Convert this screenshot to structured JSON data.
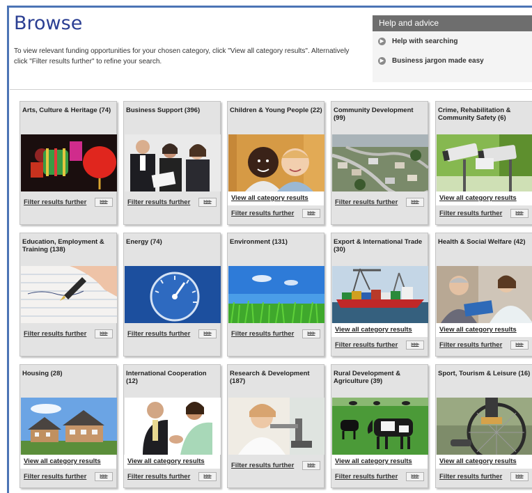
{
  "page": {
    "title": "Browse",
    "intro": "To view relevant funding opportunities for your chosen category, click \"View all category results\". Alternatively click \"Filter results further\" to refine your search."
  },
  "help": {
    "heading": "Help and advice",
    "items": [
      "Help with searching",
      "Business jargon made easy"
    ]
  },
  "labels": {
    "view_all": "View all category results",
    "filter": "Filter results further"
  },
  "icons": {
    "bullet": "arrow-bullet-icon",
    "arrows": "triple-arrow-icon"
  },
  "categories": [
    {
      "title": "Arts, Culture & Heritage (74)",
      "image": "red-lanterns",
      "has_view_all": false
    },
    {
      "title": "Business Support (396)",
      "image": "business-people",
      "has_view_all": false
    },
    {
      "title": "Children & Young People (22)",
      "image": "two-children",
      "has_view_all": true
    },
    {
      "title": "Community Development (99)",
      "image": "aerial-housing-estate",
      "has_view_all": false
    },
    {
      "title": "Crime, Rehabilitation & Community Safety (6)",
      "image": "cctv-cameras",
      "has_view_all": true
    },
    {
      "title": "Education, Employment & Training (138)",
      "image": "hand-writing",
      "has_view_all": false
    },
    {
      "title": "Energy (74)",
      "image": "meter-dial",
      "has_view_all": false
    },
    {
      "title": "Environment (131)",
      "image": "grass-sky",
      "has_view_all": false
    },
    {
      "title": "Export & International Trade (30)",
      "image": "container-ship",
      "has_view_all": true
    },
    {
      "title": "Health & Social Welfare (42)",
      "image": "nurse-patient",
      "has_view_all": true
    },
    {
      "title": "Housing (28)",
      "image": "houses",
      "has_view_all": true
    },
    {
      "title": "International Cooperation (12)",
      "image": "handshake",
      "has_view_all": true
    },
    {
      "title": "Research & Development (187)",
      "image": "scientist-microscope",
      "has_view_all": false
    },
    {
      "title": "Rural Development & Agriculture (39)",
      "image": "cows-field",
      "has_view_all": true
    },
    {
      "title": "Sport, Tourism & Leisure (16)",
      "image": "bicycle-wheel",
      "has_view_all": true
    }
  ]
}
